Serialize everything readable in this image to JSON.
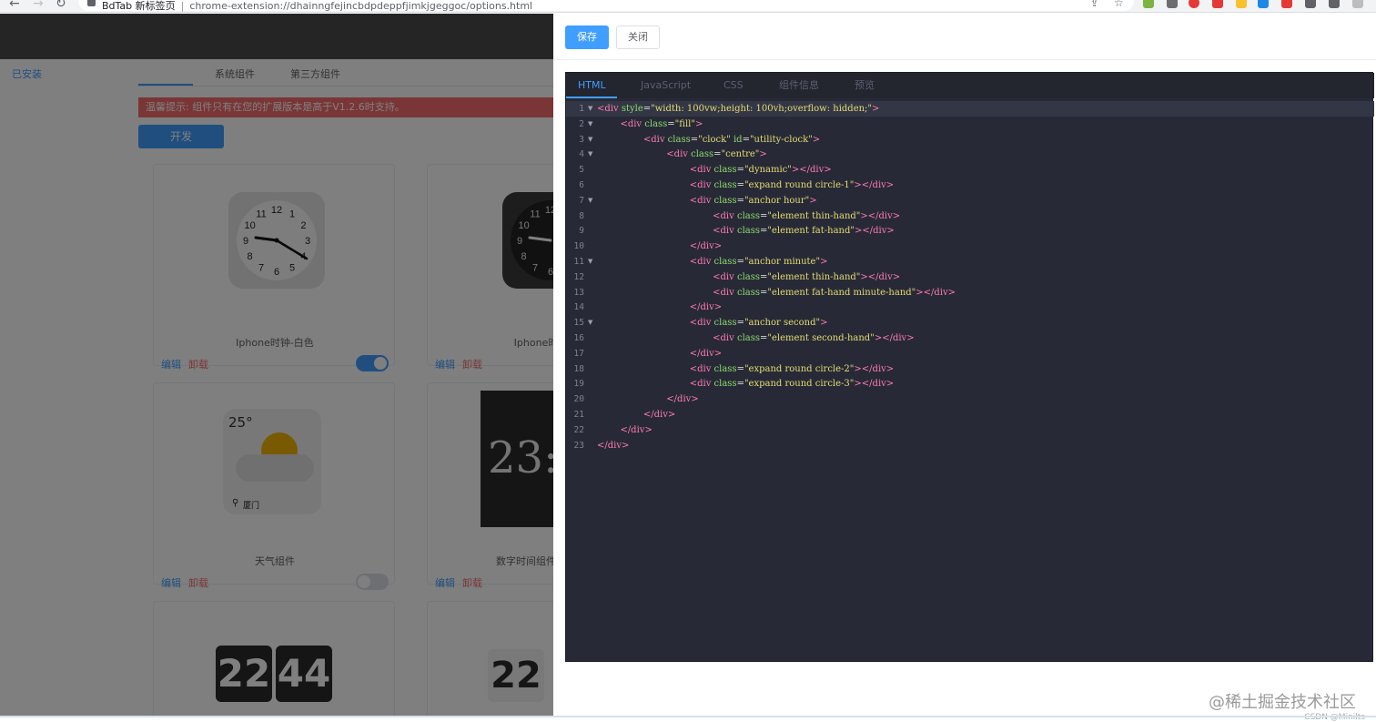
{
  "browser": {
    "tab_title": "BdTab 新标签页",
    "url": "chrome-extension://dhainngfejincbdpdeppfjimkjgeggoc/options.html"
  },
  "page": {
    "tabs": [
      "已安装",
      "系统组件",
      "第三方组件"
    ],
    "notice": "温馨提示:  组件只有在您的扩展版本是高于V1.2.6时支持。",
    "dev_button": "开发",
    "edit_label": "编辑",
    "uninstall_label": "卸载",
    "cards": [
      {
        "name": "Iphone时钟-白色",
        "enabled": true
      },
      {
        "name": "Iphone时",
        "enabled": null
      },
      {
        "name": "天气组件",
        "enabled": false,
        "temp": "25°",
        "city": "厦门"
      },
      {
        "name": "数字时间组件（透",
        "enabled": null,
        "time": "23:"
      },
      {
        "name": "",
        "flip_h": "22",
        "flip_m": "44"
      },
      {
        "name": "",
        "flip_h": "22",
        "flip_m": ""
      }
    ],
    "clock_numbers": [
      "12",
      "1",
      "2",
      "3",
      "4",
      "5",
      "6",
      "7",
      "8",
      "9",
      "10",
      "11"
    ]
  },
  "drawer": {
    "save_label": "保存",
    "close_label": "关闭",
    "editor_tabs": [
      "HTML",
      "JavaScript",
      "CSS",
      "组件信息",
      "预览"
    ],
    "active_tab": "HTML",
    "code_lines": [
      "<div style=\"width: 100vw;height: 100vh;overflow: hidden;\">",
      "    <div class=\"fill\">",
      "        <div class=\"clock\" id=\"utility-clock\">",
      "            <div class=\"centre\">",
      "                <div class=\"dynamic\"></div>",
      "                <div class=\"expand round circle-1\"></div>",
      "                <div class=\"anchor hour\">",
      "                    <div class=\"element thin-hand\"></div>",
      "                    <div class=\"element fat-hand\"></div>",
      "                </div>",
      "                <div class=\"anchor minute\">",
      "                    <div class=\"element thin-hand\"></div>",
      "                    <div class=\"element fat-hand minute-hand\"></div>",
      "                </div>",
      "                <div class=\"anchor second\">",
      "                    <div class=\"element second-hand\"></div>",
      "                </div>",
      "                <div class=\"expand round circle-2\"></div>",
      "                <div class=\"expand round circle-3\"></div>",
      "            </div>",
      "        </div>",
      "    </div>",
      "</div>"
    ],
    "fold_lines": [
      1,
      2,
      3,
      4,
      7,
      11,
      15
    ]
  },
  "watermark": {
    "main": "@稀土掘金技术社区",
    "sub": "CSDN @Minilts"
  },
  "colors": {
    "accent": "#409eff",
    "danger": "#f56c6c",
    "editor_bg": "#272a36"
  }
}
